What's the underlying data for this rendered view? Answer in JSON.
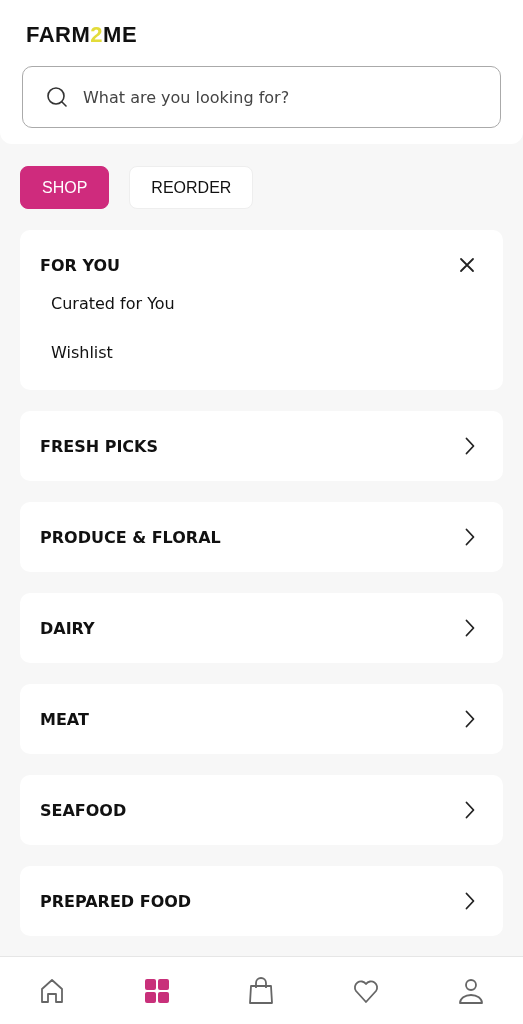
{
  "logo": {
    "before": "FARM",
    "mark": "2",
    "after": "ME"
  },
  "search": {
    "placeholder": "What are you looking for?"
  },
  "tabs": [
    {
      "label": "SHOP",
      "selected": true
    },
    {
      "label": "REORDER",
      "selected": false
    }
  ],
  "categories": [
    {
      "title": "FOR YOU",
      "expanded": true,
      "children": [
        {
          "label": "Curated for You"
        },
        {
          "label": "Wishlist"
        }
      ]
    },
    {
      "title": "FRESH PICKS",
      "expanded": false
    },
    {
      "title": "PRODUCE & FLORAL",
      "expanded": false
    },
    {
      "title": "DAIRY",
      "expanded": false
    },
    {
      "title": "MEAT",
      "expanded": false
    },
    {
      "title": "SEAFOOD",
      "expanded": false
    },
    {
      "title": "PREPARED FOOD",
      "expanded": false
    }
  ],
  "nav": [
    {
      "kind": "home",
      "selected": false
    },
    {
      "kind": "grid",
      "selected": true
    },
    {
      "kind": "bag",
      "selected": false
    },
    {
      "kind": "heart",
      "selected": false
    },
    {
      "kind": "person",
      "selected": false
    }
  ]
}
